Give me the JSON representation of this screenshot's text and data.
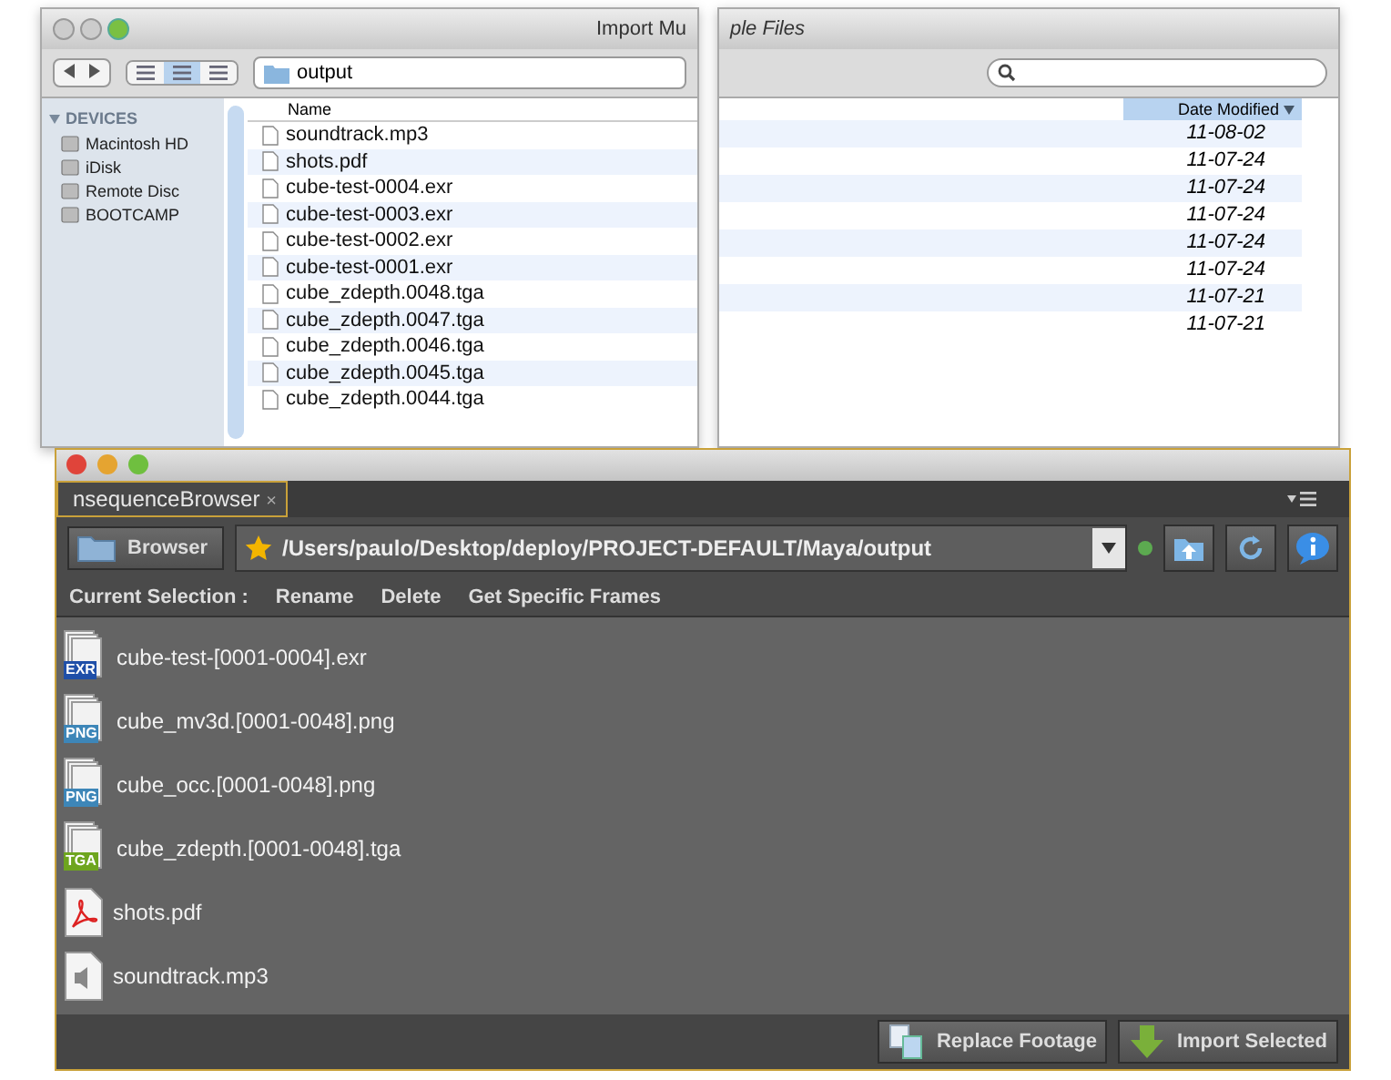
{
  "finder": {
    "title_left": "Import Mu",
    "title_right": "ple Files",
    "location": "output",
    "view_modes": [
      {
        "selected": false
      },
      {
        "selected": true
      },
      {
        "selected": false
      }
    ],
    "sidebar": {
      "heading": "DEVICES",
      "items": [
        "Macintosh HD",
        "iDisk",
        "Remote Disc",
        "BOOTCAMP"
      ]
    },
    "columns": {
      "name": "Name",
      "date": "Date Modified"
    },
    "files": [
      "soundtrack.mp3",
      "shots.pdf",
      "cube-test-0004.exr",
      "cube-test-0003.exr",
      "cube-test-0002.exr",
      "cube-test-0001.exr",
      "cube_zdepth.0048.tga",
      "cube_zdepth.0047.tga",
      "cube_zdepth.0046.tga",
      "cube_zdepth.0045.tga",
      "cube_zdepth.0044.tga"
    ],
    "dates": [
      "11-08-02",
      "11-07-24",
      "11-07-24",
      "11-07-24",
      "11-07-24",
      "11-07-24",
      "11-07-21",
      "11-07-21"
    ]
  },
  "panel": {
    "tab": {
      "label": "nsequenceBrowser",
      "close": "×"
    },
    "browse_button": "Browser",
    "path": "/Users/paulo/Desktop/deploy/PROJECT-DEFAULT/Maya/output",
    "actions_label": "Current Selection :",
    "actions": [
      "Rename",
      "Delete",
      "Get Specific Frames"
    ],
    "items": [
      {
        "name": "cube-test-[0001-0004].exr",
        "kind": "sequence",
        "badge": "EXR",
        "color": "#1f4fa8"
      },
      {
        "name": "cube_mv3d.[0001-0048].png",
        "kind": "sequence",
        "badge": "PNG",
        "color": "#3d86b8"
      },
      {
        "name": "cube_occ.[0001-0048].png",
        "kind": "sequence",
        "badge": "PNG",
        "color": "#3d86b8"
      },
      {
        "name": "cube_zdepth.[0001-0048].tga",
        "kind": "sequence",
        "badge": "TGA",
        "color": "#6ea51e"
      },
      {
        "name": "shots.pdf",
        "kind": "pdf"
      },
      {
        "name": "soundtrack.mp3",
        "kind": "audio"
      }
    ],
    "footer_buttons": [
      {
        "label": "Replace Footage",
        "kind": "replace"
      },
      {
        "label": "Import Selected",
        "kind": "import"
      }
    ]
  }
}
